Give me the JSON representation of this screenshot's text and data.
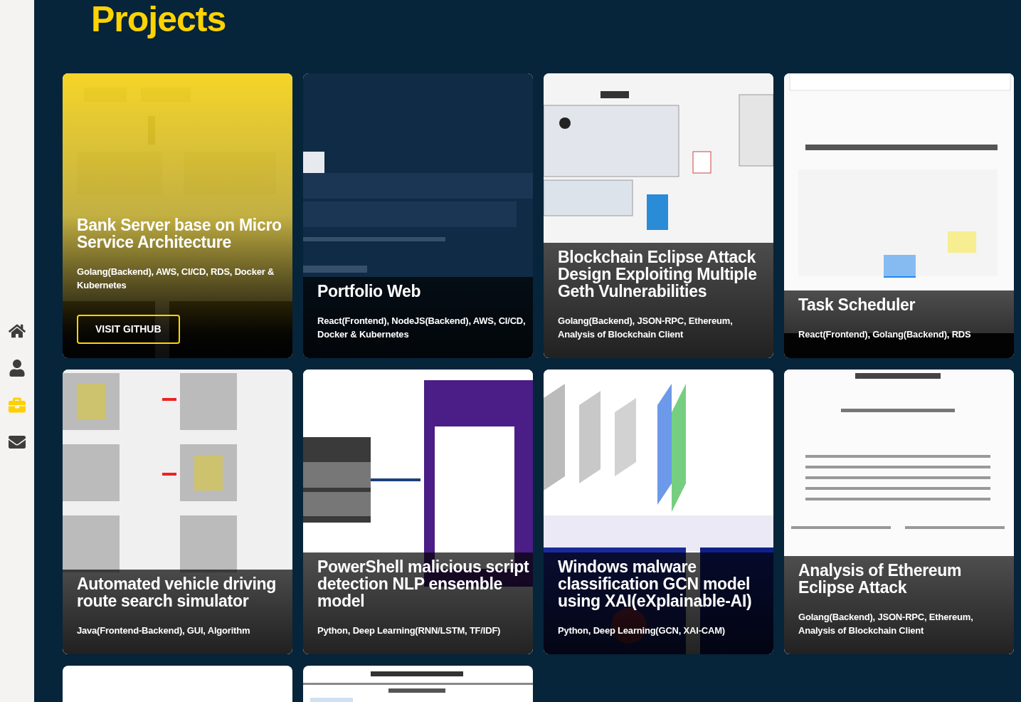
{
  "nav": [
    {
      "kind": "home",
      "selected": false
    },
    {
      "kind": "person",
      "selected": false
    },
    {
      "kind": "briefcase",
      "selected": true
    },
    {
      "kind": "mail",
      "selected": false
    }
  ],
  "heading": "Projects",
  "projects": [
    {
      "title": "Bank Server base on Micro Service Architecture",
      "tech": "Golang(Backend), AWS, CI/CD, RDS, Docker & Kubernetes",
      "highlighted": true,
      "button": "VISIT GITHUB"
    },
    {
      "title": "Portfolio Web",
      "tech": "React(Frontend), NodeJS(Backend), AWS, CI/CD, Docker & Kubernetes",
      "highlighted": false
    },
    {
      "title": "Blockchain Eclipse Attack Design Exploiting Multiple Geth Vulnerabilities",
      "tech": "Golang(Backend), JSON-RPC, Ethereum, Analysis of Blockchain Client",
      "highlighted": false
    },
    {
      "title": "Task Scheduler",
      "tech": "React(Frontend), Golang(Backend), RDS",
      "highlighted": false
    },
    {
      "title": "Automated vehicle driving route search simulator",
      "tech": "Java(Frontend-Backend), GUI, Algorithm",
      "highlighted": false
    },
    {
      "title": "PowerShell malicious script detection NLP ensemble model",
      "tech": "Python, Deep Learning(RNN/LSTM, TF/IDF)",
      "highlighted": false
    },
    {
      "title": "Windows malware classification GCN model using XAI(eXplainable-AI)",
      "tech": "Python, Deep Learning(GCN, XAI-CAM)",
      "highlighted": false
    },
    {
      "title": "Analysis of Ethereum Eclipse Attack",
      "tech": "Golang(Backend), JSON-RPC, Ethereum, Analysis of Blockchain Client",
      "highlighted": false
    },
    {
      "kind": "picture"
    },
    {
      "kind": "picture"
    }
  ]
}
